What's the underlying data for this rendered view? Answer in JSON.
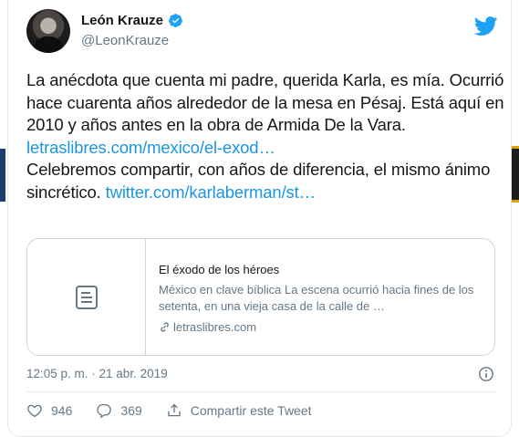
{
  "author": {
    "display_name": "León Krauze",
    "handle": "@LeonKrauze",
    "verified": true
  },
  "tweet": {
    "line1": "La anécdota que cuenta mi padre, querida Karla, es mía. Ocurrió hace cuarenta años alrededor de la mesa en Pésaj. Está aquí en 2010 y años antes en la obra de Armida De la Vara.",
    "link1": "letraslibres.com/mexico/el-exod…",
    "line2": "Celebremos compartir, con años de diferencia, el mismo ánimo sincrético.",
    "link2": "twitter.com/karlaberman/st…"
  },
  "preview": {
    "title": "El éxodo de los héroes",
    "description": "México en clave bíblica La escena ocurrió hacia fines de los setenta, en una vieja casa de la calle de …",
    "domain": "letraslibres.com"
  },
  "meta": {
    "timestamp": "12:05 p. m. · 21 abr. 2019"
  },
  "actions": {
    "likes": "946",
    "replies": "369",
    "share_label": "Compartir este Tweet"
  },
  "icons": {
    "brand": "twitter-bird-icon",
    "verified": "verified-badge-icon",
    "info": "info-icon",
    "like": "heart-icon",
    "reply": "reply-bubble-icon",
    "share": "share-icon",
    "document": "document-icon",
    "link": "link-icon"
  },
  "colors": {
    "brand_blue": "#1da1f2",
    "link_blue": "#1b95e0",
    "muted": "#657786",
    "text": "#14171a"
  }
}
